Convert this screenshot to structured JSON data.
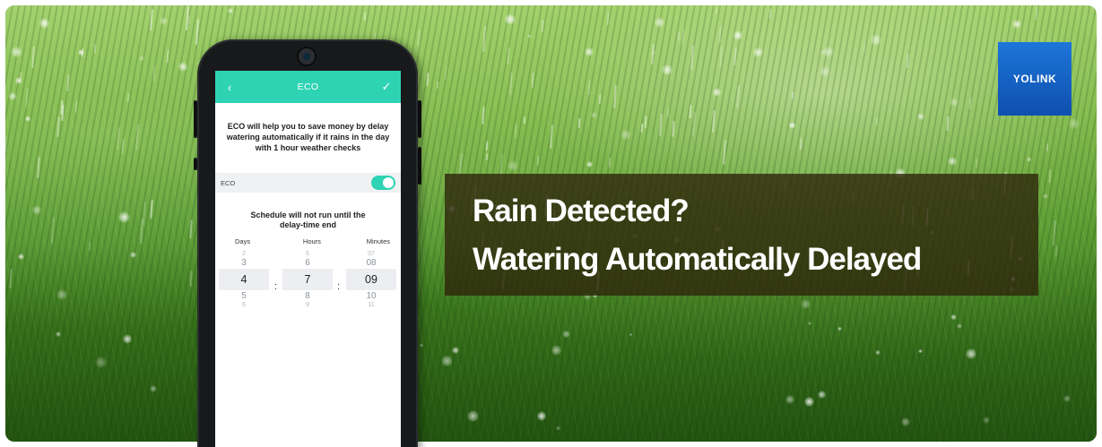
{
  "headline": {
    "line1": "Rain Detected?",
    "line2": "Watering Automatically Delayed"
  },
  "brand": {
    "logo_text": "YOLINK",
    "color": "#1c76d8"
  },
  "app": {
    "accent_color": "#2ed3b4",
    "header": {
      "title": "ECO",
      "back_icon": "chevron-left-icon",
      "confirm_icon": "check-icon"
    },
    "description": "ECO will help you to save money by delay watering automatically if it rains in the day with 1 hour weather checks",
    "eco_toggle": {
      "label": "ECO",
      "state": "on"
    },
    "schedule_notice": "Schedule will not run until the delay-time end",
    "picker": {
      "columns": [
        {
          "label": "Days",
          "above_faint": "2",
          "above": "3",
          "selected": "4",
          "below": "5",
          "below_faint": "6"
        },
        {
          "label": "Hours",
          "above_faint": "5",
          "above": "6",
          "selected": "7",
          "below": "8",
          "below_faint": "9"
        },
        {
          "label": "Minutes",
          "above_faint": "07",
          "above": "08",
          "selected": "09",
          "below": "10",
          "below_faint": "11"
        }
      ],
      "separator": ":"
    }
  }
}
